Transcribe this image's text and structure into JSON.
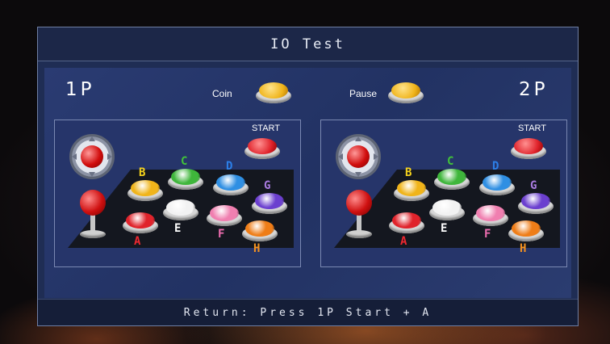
{
  "screen": {
    "title": "IO Test",
    "footer": "Return: Press 1P Start + A"
  },
  "labels": {
    "p1": "1P",
    "p2": "2P",
    "coin": "Coin",
    "pause": "Pause"
  },
  "panels": [
    {
      "id": "p1",
      "start_label": "START",
      "buttons": [
        {
          "key": "B",
          "label": "B",
          "color": "#f0b41a",
          "letter_color": "#f5d21c"
        },
        {
          "key": "C",
          "label": "C",
          "color": "#3fb63b",
          "letter_color": "#41c23a"
        },
        {
          "key": "D",
          "label": "D",
          "color": "#2f8fe3",
          "letter_color": "#2c7fe8"
        },
        {
          "key": "G",
          "label": "G",
          "color": "#6b3fcf",
          "letter_color": "#a97be0"
        },
        {
          "key": "A",
          "label": "A",
          "color": "#e0232b",
          "letter_color": "#ef2830"
        },
        {
          "key": "E",
          "label": "E",
          "color": "#f2f2f2",
          "letter_color": "#ffffff"
        },
        {
          "key": "F",
          "label": "F",
          "color": "#f07fb0",
          "letter_color": "#f06eb1"
        },
        {
          "key": "H",
          "label": "H",
          "color": "#ef7d17",
          "letter_color": "#f59220"
        }
      ]
    },
    {
      "id": "p2",
      "start_label": "START",
      "buttons": [
        {
          "key": "B",
          "label": "B",
          "color": "#f0b41a",
          "letter_color": "#f5d21c"
        },
        {
          "key": "C",
          "label": "C",
          "color": "#3fb63b",
          "letter_color": "#41c23a"
        },
        {
          "key": "D",
          "label": "D",
          "color": "#2f8fe3",
          "letter_color": "#2c7fe8"
        },
        {
          "key": "G",
          "label": "G",
          "color": "#6b3fcf",
          "letter_color": "#a97be0"
        },
        {
          "key": "A",
          "label": "A",
          "color": "#e0232b",
          "letter_color": "#ef2830"
        },
        {
          "key": "E",
          "label": "E",
          "color": "#f2f2f2",
          "letter_color": "#ffffff"
        },
        {
          "key": "F",
          "label": "F",
          "color": "#f07fb0",
          "letter_color": "#f06eb1"
        },
        {
          "key": "H",
          "label": "H",
          "color": "#ef7d17",
          "letter_color": "#f59220"
        }
      ]
    }
  ],
  "colors": {
    "coin_button": "#f0b41a",
    "pause_button": "#f0b41a",
    "start_button": "#e0232b"
  }
}
